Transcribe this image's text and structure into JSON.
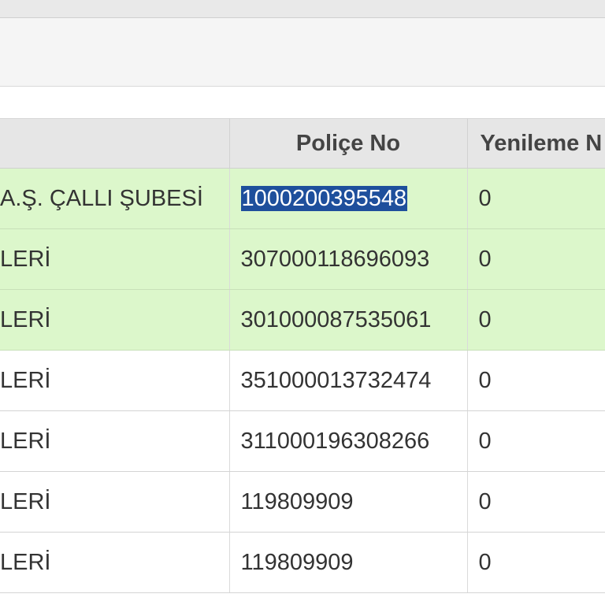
{
  "columns": {
    "col1": "",
    "police_no": "Poliçe No",
    "yenileme": "Yenileme N"
  },
  "rows": [
    {
      "name": "A.Ş. ÇALLI ŞUBESİ",
      "police_no": "1000200395548",
      "yenileme": "0",
      "highlighted": true,
      "police_selected": true
    },
    {
      "name": "LERİ",
      "police_no": "307000118696093",
      "yenileme": "0",
      "highlighted": true
    },
    {
      "name": "LERİ",
      "police_no": "301000087535061",
      "yenileme": "0",
      "highlighted": true
    },
    {
      "name": "LERİ",
      "police_no": "351000013732474",
      "yenileme": "0",
      "highlighted": false
    },
    {
      "name": "LERİ",
      "police_no": "311000196308266",
      "yenileme": "0",
      "highlighted": false
    },
    {
      "name": "LERİ",
      "police_no": "119809909",
      "yenileme": "0",
      "highlighted": false
    },
    {
      "name": "LERİ",
      "police_no": "119809909",
      "yenileme": "0",
      "highlighted": false
    }
  ],
  "colors": {
    "highlight_row": "#dcf7cb",
    "selection": "#1e4f9c",
    "header_bg": "#e6e6e6"
  }
}
